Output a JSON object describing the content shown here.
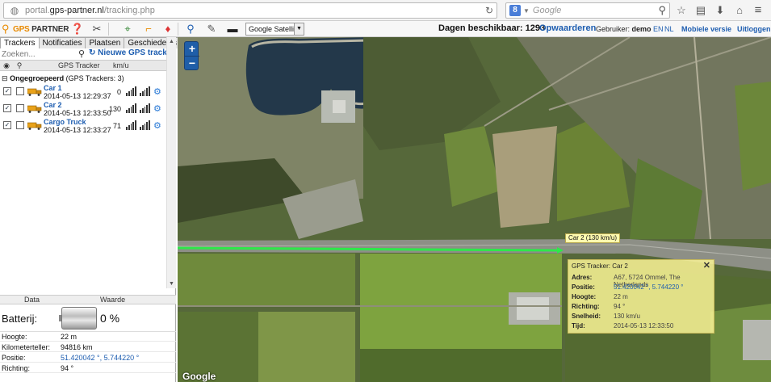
{
  "browser": {
    "url_prefix": "portal.",
    "url_domain": "gps-partner.nl",
    "url_path": "/tracking.php",
    "search_engine_badge": "8",
    "search_placeholder": "Google"
  },
  "toolbar": {
    "logo_gps": "GPS",
    "logo_partner": " PARTNER",
    "map_type": "Google Satellite",
    "days_label": "Dagen beschikbaar: 1293",
    "upgrade_label": "Opwaarderen",
    "user_prefix": "Gebruiker:",
    "user_name": "demo",
    "lang_en": "EN",
    "lang_nl": "NL",
    "mobile_label": "Mobiele versie",
    "logout_label": "Uitloggen"
  },
  "sidebar": {
    "tabs": [
      "Trackers",
      "Notificaties",
      "Plaatsen",
      "Geschiedenis"
    ],
    "search_placeholder": "Zoeken...",
    "new_tracker_label": "Nieuwe GPS tracker",
    "columns": {
      "gps": "GPS Tracker",
      "speed": "km/u"
    },
    "group_label": "Ongegroepeerd",
    "group_count": "(GPS Trackers: 3)",
    "trackers": [
      {
        "name": "Car 1",
        "time": "2014-05-13 12:29:37",
        "speed": "0"
      },
      {
        "name": "Car 2",
        "time": "2014-05-13 12:33:50",
        "speed": "130"
      },
      {
        "name": "Cargo Truck",
        "time": "2014-05-13 12:33:27",
        "speed": "71"
      }
    ],
    "detail_head": {
      "data": "Data",
      "value": "Waarde"
    },
    "battery_label": "Batterij:",
    "battery_value": "0 %",
    "details": [
      {
        "key": "Hoogte:",
        "value": "22 m"
      },
      {
        "key": "Kilometerteller:",
        "value": "94816 km"
      },
      {
        "key": "Positie:",
        "value": "51.420042 °, 5.744220 °"
      },
      {
        "key": "Richting:",
        "value": "94 °"
      }
    ]
  },
  "map": {
    "car_label": "Car 2 (130 km/u)",
    "popup": {
      "title": "GPS Tracker: Car 2",
      "rows": [
        {
          "key": "Adres:",
          "value": "A67, 5724 Ommel, The Netherlands"
        },
        {
          "key": "Positie:",
          "value": "51.420042 °, 5.744220 °"
        },
        {
          "key": "Hoogte:",
          "value": "22 m"
        },
        {
          "key": "Richting:",
          "value": "94 °"
        },
        {
          "key": "Snelheid:",
          "value": "130 km/u"
        },
        {
          "key": "Tijd:",
          "value": "2014-05-13 12:33:50"
        }
      ]
    },
    "zoom_in": "+",
    "zoom_out": "−",
    "attribution": "Google"
  },
  "colors": {
    "accent": "#1d5db0",
    "brand": "#e98a00",
    "track": "#2ee84a",
    "popup": "#faf596"
  }
}
